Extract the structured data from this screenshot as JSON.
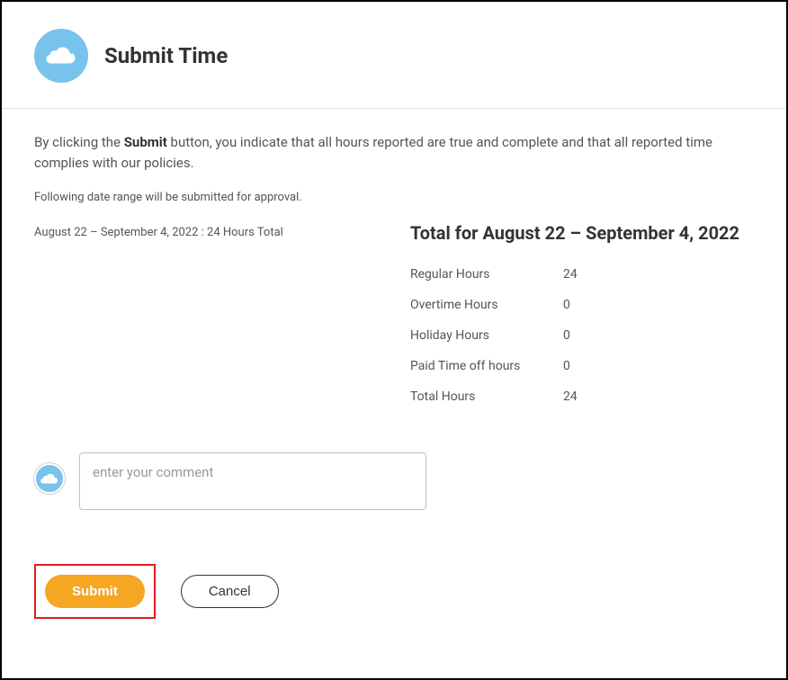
{
  "header": {
    "title": "Submit Time"
  },
  "disclaimer": {
    "prefix": "By clicking the ",
    "bold": "Submit",
    "suffix": " button, you indicate that all hours reported are true and complete and that all reported time complies with our policies."
  },
  "approval_note": "Following date range will be submitted for approval.",
  "range_summary": "August 22 – September 4, 2022 : 24 Hours Total",
  "totals": {
    "heading": "Total for August 22 – September 4, 2022",
    "rows": [
      {
        "label": "Regular Hours",
        "value": "24"
      },
      {
        "label": "Overtime Hours",
        "value": "0"
      },
      {
        "label": "Holiday Hours",
        "value": "0"
      },
      {
        "label": "Paid Time off hours",
        "value": "0"
      },
      {
        "label": "Total Hours",
        "value": "24"
      }
    ]
  },
  "comment": {
    "placeholder": "enter your comment"
  },
  "buttons": {
    "submit": "Submit",
    "cancel": "Cancel"
  }
}
